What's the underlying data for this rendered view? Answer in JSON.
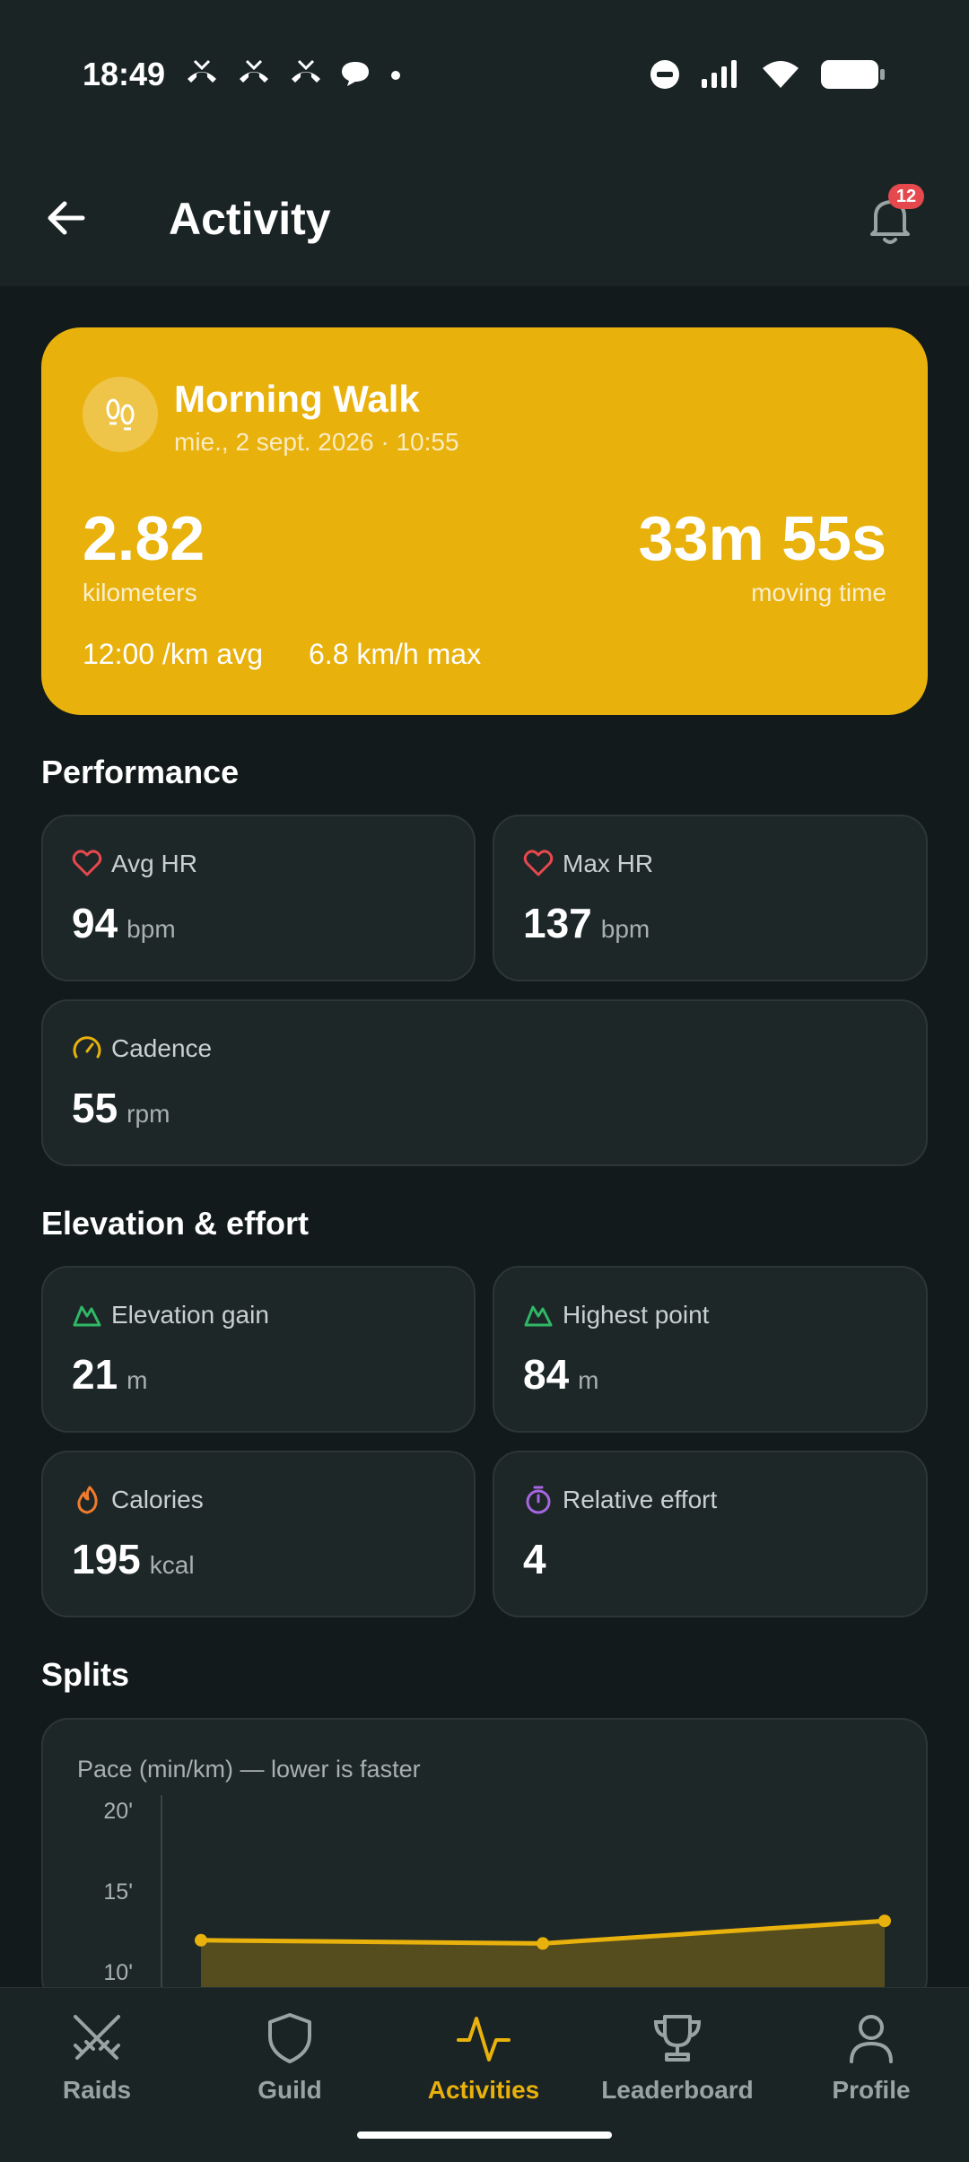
{
  "status_bar": {
    "time": "18:49",
    "left_icons": [
      "missed-call-icon",
      "missed-call-icon",
      "missed-call-icon",
      "chat-bubble-icon",
      "dot-icon"
    ],
    "right_icons": [
      "do-not-disturb-icon",
      "signal-icon",
      "wifi-icon",
      "battery-icon"
    ]
  },
  "header": {
    "title": "Activity",
    "notification_count": "12"
  },
  "hero": {
    "icon": "footprints-icon",
    "title": "Morning Walk",
    "subtitle": "mie., 2 sept. 2026 · 10:55",
    "distance_value": "2.82",
    "distance_label": "kilometers",
    "time_value": "33m 55s",
    "time_label": "moving time",
    "pace": "12:00 /km avg",
    "max_speed": "6.8 km/h max",
    "accent": "#e9b10c"
  },
  "performance": {
    "title": "Performance",
    "avg_hr": {
      "label": "Avg HR",
      "value": "94",
      "unit": "bpm",
      "icon": "heart-icon"
    },
    "max_hr": {
      "label": "Max HR",
      "value": "137",
      "unit": "bpm",
      "icon": "heart-icon"
    },
    "cadence": {
      "label": "Cadence",
      "value": "55",
      "unit": "rpm",
      "icon": "gauge-icon"
    }
  },
  "elevation": {
    "title": "Elevation & effort",
    "gain": {
      "label": "Elevation gain",
      "value": "21",
      "unit": "m",
      "icon": "mountain-icon"
    },
    "highest": {
      "label": "Highest point",
      "value": "84",
      "unit": "m",
      "icon": "mountain-icon"
    },
    "calories": {
      "label": "Calories",
      "value": "195",
      "unit": "kcal",
      "icon": "flame-icon"
    },
    "effort": {
      "label": "Relative effort",
      "value": "4",
      "icon": "stopwatch-icon"
    }
  },
  "splits": {
    "title": "Splits",
    "chart_title": "Pace (min/km) — lower is faster"
  },
  "chart_data": {
    "type": "area",
    "title": "Pace (min/km) — lower is faster",
    "y_tick_labels": [
      "20'",
      "15'",
      "10'"
    ],
    "y_ticks": [
      20,
      15,
      10
    ],
    "ylim": [
      10,
      20
    ],
    "x": [
      1,
      2,
      3
    ],
    "series": [
      {
        "values": [
          11.9,
          11.7,
          13.1
        ]
      }
    ],
    "color": "#e9b10c"
  },
  "nav": {
    "items": [
      {
        "label": "Raids",
        "icon": "crossed-swords-icon"
      },
      {
        "label": "Guild",
        "icon": "shield-icon"
      },
      {
        "label": "Activities",
        "icon": "activity-pulse-icon"
      },
      {
        "label": "Leaderboard",
        "icon": "trophy-icon"
      },
      {
        "label": "Profile",
        "icon": "person-icon"
      }
    ],
    "active": "Activities",
    "active_color": "#e9b10c"
  }
}
